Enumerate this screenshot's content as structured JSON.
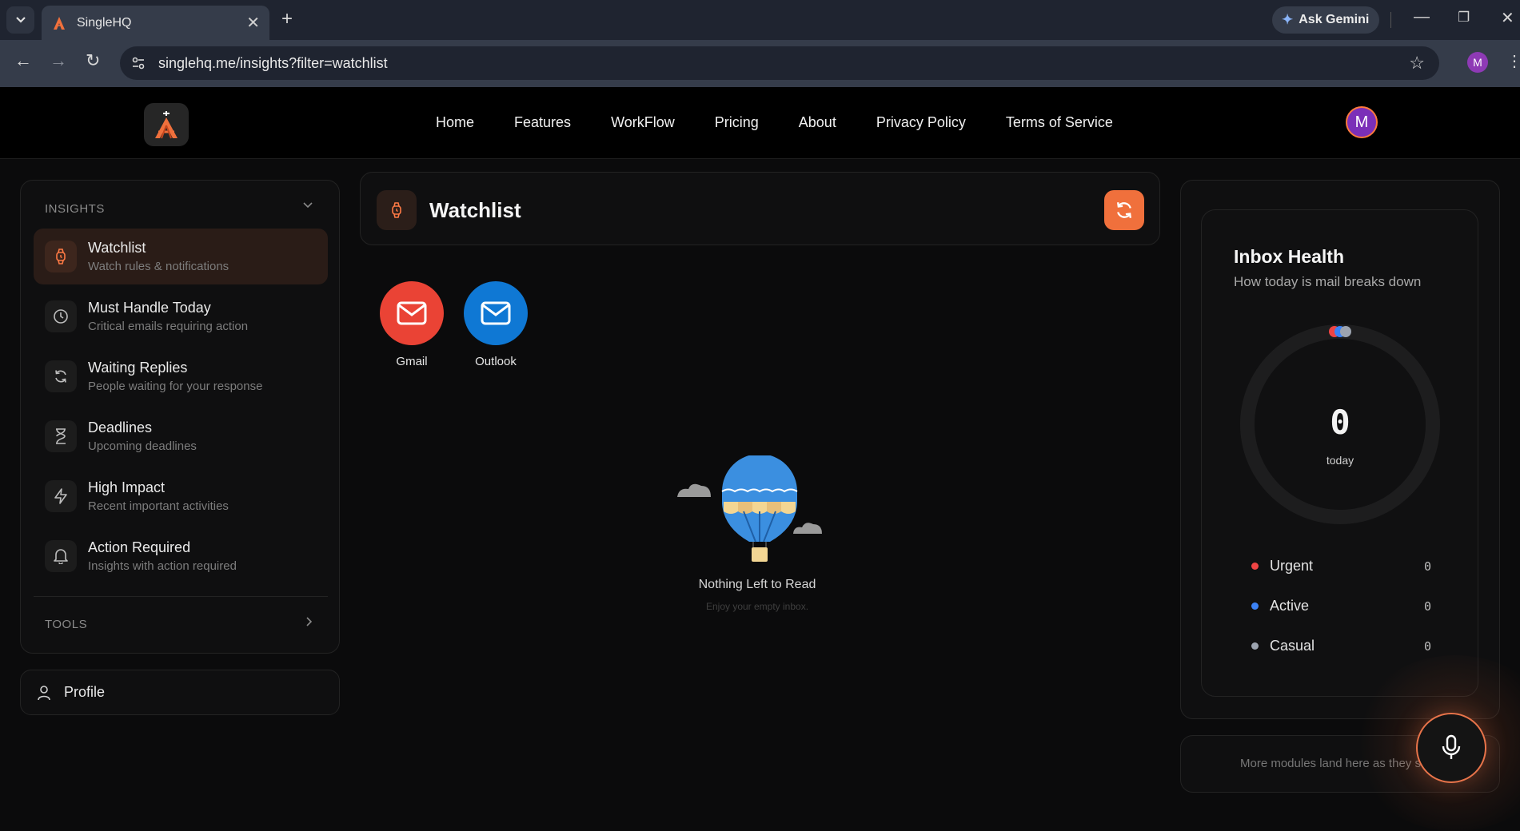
{
  "browser": {
    "tab_title": "SingleHQ",
    "ask_gemini": "Ask Gemini",
    "url": "singlehq.me/insights?filter=watchlist",
    "profile_initial": "M"
  },
  "header": {
    "nav": [
      "Home",
      "Features",
      "WorkFlow",
      "Pricing",
      "About",
      "Privacy Policy",
      "Terms of Service"
    ],
    "user_initial": "M"
  },
  "sidebar": {
    "insights_heading": "INSIGHTS",
    "items": [
      {
        "label": "Watchlist",
        "sub": "Watch rules & notifications",
        "icon": "watch-icon",
        "active": true
      },
      {
        "label": "Must Handle Today",
        "sub": "Critical emails requiring action",
        "icon": "clock-icon"
      },
      {
        "label": "Waiting Replies",
        "sub": "People waiting for your response",
        "icon": "refresh-icon"
      },
      {
        "label": "Deadlines",
        "sub": "Upcoming deadlines",
        "icon": "hourglass-icon"
      },
      {
        "label": "High Impact",
        "sub": "Recent important activities",
        "icon": "bolt-icon"
      },
      {
        "label": "Action Required",
        "sub": "Insights with action required",
        "icon": "bell-icon"
      }
    ],
    "tools_heading": "TOOLS",
    "profile_label": "Profile"
  },
  "main": {
    "title": "Watchlist",
    "providers": [
      {
        "name": "Gmail",
        "color": "#ea4335"
      },
      {
        "name": "Outlook",
        "color": "#0f78d4"
      }
    ],
    "empty_title": "Nothing Left to Read",
    "empty_sub": "Enjoy your empty inbox."
  },
  "inbox_health": {
    "title": "Inbox Health",
    "subtitle": "How today is mail breaks down",
    "total": "0",
    "total_label": "today",
    "legend": [
      {
        "label": "Urgent",
        "value": "0",
        "color": "#ef4444"
      },
      {
        "label": "Active",
        "value": "0",
        "color": "#3b82f6"
      },
      {
        "label": "Casual",
        "value": "0",
        "color": "#9ca3af"
      }
    ]
  },
  "more_modules": "More modules land here as they ship"
}
